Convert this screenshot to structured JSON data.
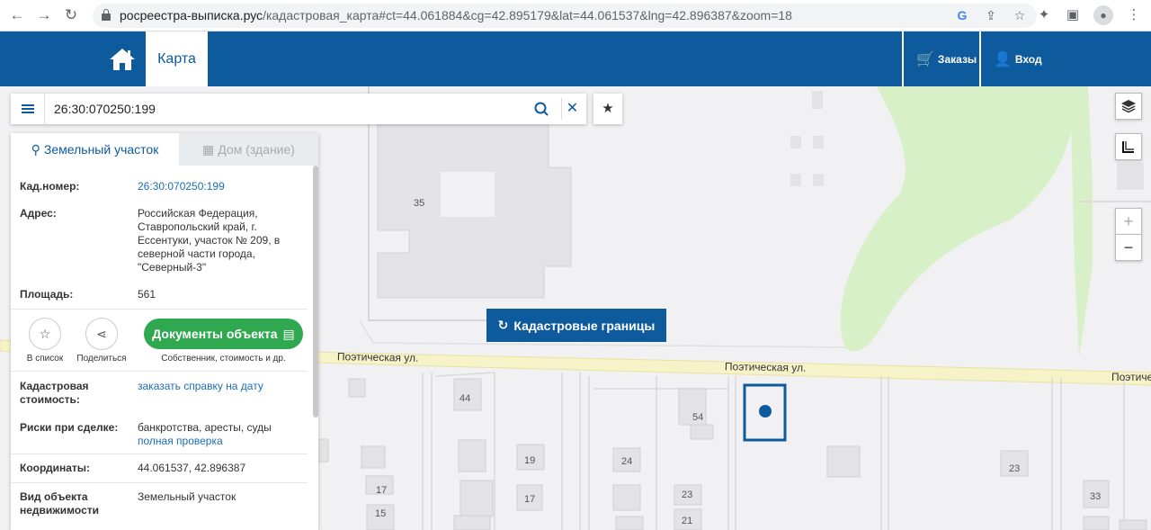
{
  "browser": {
    "url_host": "росреестра-выписка.рус",
    "url_path": "/кадастровая_карта#ct=44.061884&cg=42.895179&lat=44.061537&lng=42.896387&zoom=18"
  },
  "header": {
    "map_tab": "Карта",
    "orders": "Заказы",
    "login": "Вход"
  },
  "search": {
    "value": "26:30:070250:199"
  },
  "panel": {
    "tab_land": "Земельный участок",
    "tab_house": "Дом (здание)",
    "cad_number_label": "Кад.номер:",
    "cad_number_value": "26:30:070250:199",
    "address_label": "Адрес:",
    "address_value": "Российская Федерация, Ставропольский край, г. Ессентуки, участок № 209, в северной части города, \"Северный-3\"",
    "area_label": "Площадь:",
    "area_value": "561",
    "to_list": "В список",
    "share": "Поделиться",
    "docs_button": "Документы объекта",
    "docs_sub": "Собственник, стоимость и др.",
    "cad_cost_label": "Кадастровая стоимость:",
    "cad_cost_value": "заказать справку на дату",
    "risks_label": "Риски при сделке:",
    "risks_value": "банкротства, аресты, суды",
    "risks_link": "полная проверка",
    "coords_label": "Координаты:",
    "coords_value": "44.061537, 42.896387",
    "type_label": "Вид объекта недвижимости",
    "type_value": "Земельный участок"
  },
  "map": {
    "cad_button": "Кадастровые границы",
    "street_1": "Поэтическая ул.",
    "street_2": "Поэтическая ул.",
    "street_3": "Поэтическая",
    "numbers": {
      "n35": "35",
      "n44": "44",
      "n54": "54",
      "n19": "19",
      "n24": "24",
      "n17a": "17",
      "n17b": "17",
      "n15": "15",
      "n23a": "23",
      "n21": "21",
      "n23b": "23",
      "n33": "33"
    }
  },
  "colors": {
    "brand": "#0d5a9c",
    "green_button": "#2fa84f",
    "park": "#d7f0c8",
    "road": "#f7f3c9"
  }
}
